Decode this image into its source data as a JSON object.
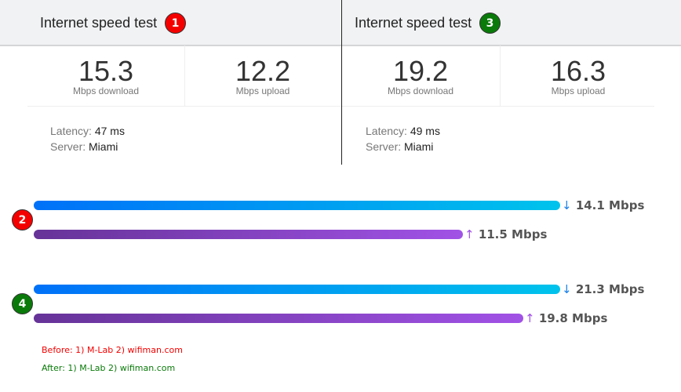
{
  "panels": [
    {
      "title": "Internet speed test",
      "badge": "1",
      "badge_color": "#f40000",
      "download": "15.3",
      "download_unit": "Mbps download",
      "upload": "12.2",
      "upload_unit": "Mbps upload",
      "latency_label": "Latency:",
      "latency": "47 ms",
      "server_label": "Server:",
      "server": "Miami"
    },
    {
      "title": "Internet speed test",
      "badge": "3",
      "badge_color": "#0a7a0a",
      "download": "19.2",
      "download_unit": "Mbps download",
      "upload": "16.3",
      "upload_unit": "Mbps upload",
      "latency_label": "Latency:",
      "latency": "49 ms",
      "server_label": "Server:",
      "server": "Miami"
    }
  ],
  "bar_groups": [
    {
      "badge": "2",
      "badge_color": "#f40000",
      "download": {
        "arrow": "↓",
        "label": "14.1 Mbps",
        "value": 14.1
      },
      "upload": {
        "arrow": "↑",
        "label": "11.5 Mbps",
        "value": 11.5
      }
    },
    {
      "badge": "4",
      "badge_color": "#0a7a0a",
      "download": {
        "arrow": "↓",
        "label": "21.3 Mbps",
        "value": 21.3
      },
      "upload": {
        "arrow": "↑",
        "label": "19.8 Mbps",
        "value": 19.8
      }
    }
  ],
  "legend": {
    "before": "Before: 1) M-Lab 2) wifiman.com",
    "before_color": "#f40000",
    "after": "After: 1) M-Lab 2) wifiman.com",
    "after_color": "#0a7a0a"
  }
}
